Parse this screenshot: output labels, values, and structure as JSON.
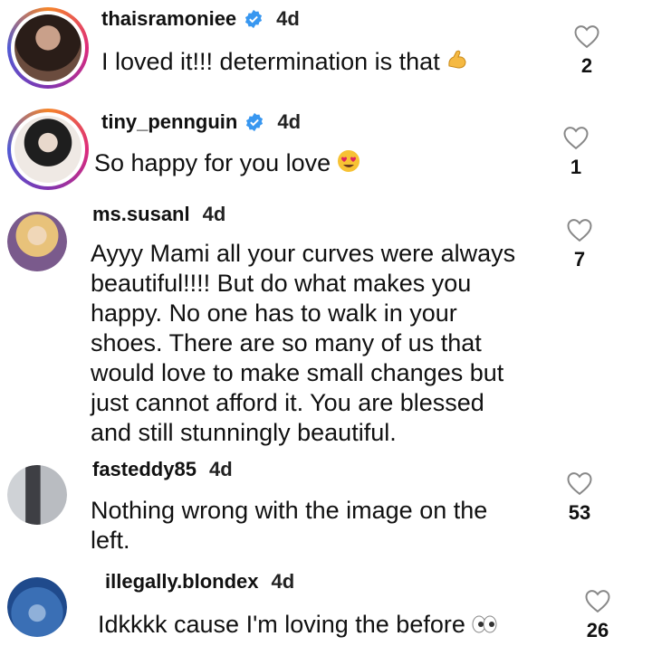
{
  "comments": [
    {
      "username": "thaisramoniee",
      "time": "4d",
      "text": "I loved it!!! determination is that",
      "emoji_icon": "flexed-biceps-icon",
      "likes": "2",
      "verified": true
    },
    {
      "username": "tiny_pennguin",
      "time": "4d",
      "text": "So happy for you love",
      "emoji_icon": "heart-eyes-icon",
      "likes": "1",
      "verified": true
    },
    {
      "username": "ms.susanl",
      "time": "4d",
      "text_lines": [
        "Ayyy Mami all your curves were always",
        "beautiful!!!! But do what makes you",
        "happy.  No one has to walk in your",
        "shoes.  There are so many of us that",
        "would love to make small changes but",
        "just cannot afford it.  You are blessed",
        "and still stunningly beautiful."
      ],
      "likes": "7",
      "verified": false
    },
    {
      "username": "fasteddy85",
      "time": "4d",
      "text_lines": [
        "Nothing wrong with the image on the",
        "left."
      ],
      "likes": "53",
      "verified": false
    },
    {
      "username": "illegally.blondex",
      "time": "4d",
      "text": "Idkkkk cause I'm loving the before",
      "emoji_icon": "eyes-icon",
      "likes": "26",
      "verified": false
    }
  ],
  "colors": {
    "verified": "#3897f0",
    "heart_stroke": "#888888",
    "text": "#111111"
  }
}
